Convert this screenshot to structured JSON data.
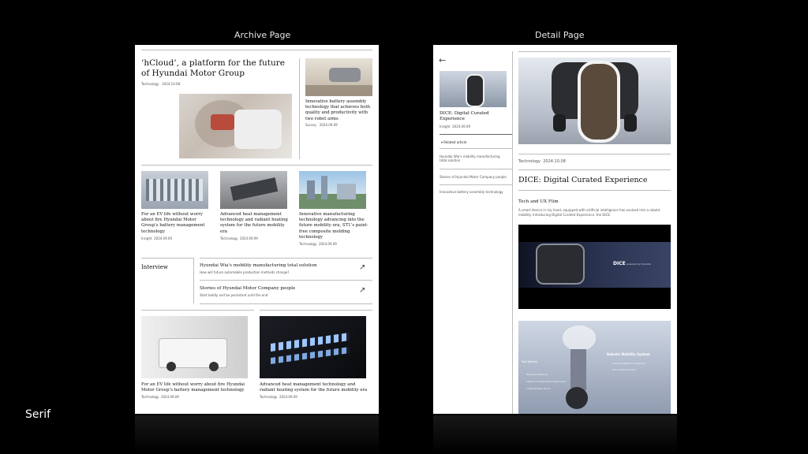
{
  "captions": {
    "archive": "Archive Page",
    "detail": "Detail Page",
    "font": "Serif"
  },
  "archive": {
    "hero": {
      "title": "‘hCloud’, a platform for the future of Hyundai Motor Group",
      "category": "Technology",
      "date": "2024.10.08"
    },
    "side": {
      "title": "Innovative battery assembly technology that achieves both quality and productivity with two robot arms",
      "category": "Survey",
      "date": "2024.09.09"
    },
    "cards": [
      {
        "title": "For an EV life without worry about fire Hyundai Motor Group’s battery management technology",
        "category": "Insight",
        "date": "2024.09.09"
      },
      {
        "title": "Advanced heat management technology and radiant heating system for the future mobility era",
        "category": "Technology",
        "date": "2024.09.09"
      },
      {
        "title": "Innovative manufacturing technology advancing into the future mobility era, ST1’s paint-free composite molding technology",
        "category": "Technology",
        "date": "2024.09.09"
      }
    ],
    "interview": {
      "label": "Interview",
      "items": [
        {
          "title": "Hyundai Wia's mobility manufacturing total solution",
          "sub": "How will future automobile production methods change?"
        },
        {
          "title": "Stories of Hyundai Motor Company people",
          "sub": "Start boldly and be persistent until the end"
        }
      ]
    },
    "bottom": [
      {
        "title": "For an EV life without worry about fire Hyundai Motor Group’s battery management technology",
        "category": "Technology",
        "date": "2024.09.09"
      },
      {
        "title": "Advanced heat management technology and radiant heating system for the future mobility era",
        "category": "Technology",
        "date": "2024.09.09"
      }
    ]
  },
  "detail": {
    "sidebar": {
      "card": {
        "title": "DICE: Digital Curated Experience",
        "category": "Insight",
        "date": "2024.09.09"
      },
      "related_label": "Related article",
      "related": [
        "Hyundai Wia's mobility manufacturing total solution",
        "Stories of Hyundai Motor Company people",
        "Innovative battery assembly technology"
      ]
    },
    "article": {
      "category": "Technology",
      "date": "2024.10.08",
      "title": "DICE: Digital Curated Experience",
      "section": "Tech and UX Film",
      "body": "A smart device in my hand, equipped with artificial intelligence has evolved into a robotic mobility. Introducing Digital Curated Experience, the DICE.",
      "banner_text": "DICE",
      "banner_sub": "powered by Hyundai",
      "diagram_tag": "Pod Module",
      "diagram_title": "Robotic Mobility System",
      "diagram_items": [
        "Multi-joint Steering",
        "Vibration Compensation Mechanism",
        "Automatic Balance Adjustment",
        "Active Lifting Actuator",
        "In-Wheel Motor Driver"
      ]
    }
  }
}
